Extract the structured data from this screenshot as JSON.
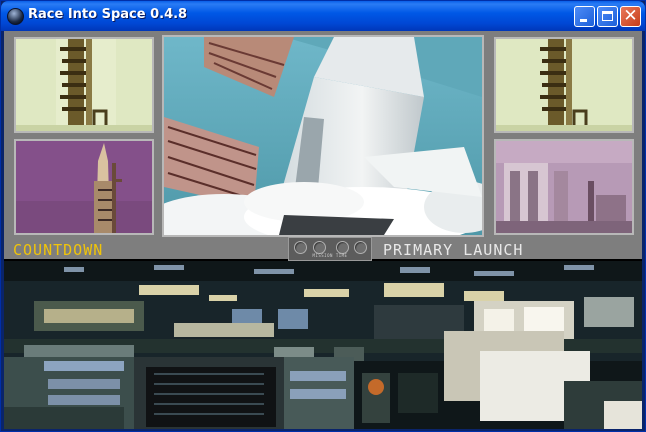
{
  "window": {
    "title": "Race Into Space 0.4.8",
    "controls": {
      "minimize": "",
      "maximize": "",
      "close": "✕"
    }
  },
  "screen": {
    "status_left": "COUNTDOWN",
    "mission_clock": {
      "label": "MISSION TIME"
    },
    "status_right": "PRIMARY LAUNCH"
  },
  "colors": {
    "countdown_text": "#f0c40a",
    "launch_text": "#e8e8e8",
    "panel_gray": "#7e7e7e",
    "titlebar_blue": "#0058e6"
  }
}
